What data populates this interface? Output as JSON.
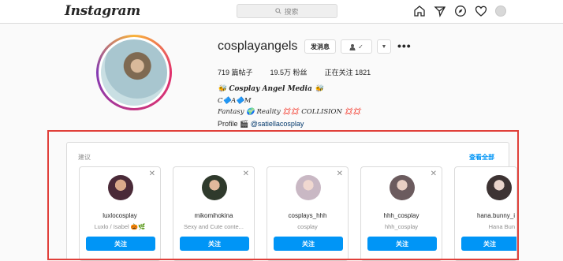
{
  "app": {
    "logo_text": "Instagram"
  },
  "search": {
    "placeholder": "搜索",
    "icon": "search-icon"
  },
  "nav": {
    "icons": [
      "home-icon",
      "direct-message-icon",
      "explore-compass-icon",
      "activity-heart-icon",
      "profile-avatar-icon"
    ]
  },
  "profile": {
    "username": "cosplayangels",
    "message_button": "发消息",
    "follow_button_icon": "person-check-icon",
    "follow_button_check": "✓",
    "dropdown_icon": "chevron-down-icon",
    "more_icon": "more-options-icon",
    "stats": {
      "posts": "719 篇帖子",
      "followers": "19.5万 粉丝",
      "following": "正在关注 1821"
    },
    "bio": {
      "line1": "𝑪𝒐𝒔𝒑𝒍𝒂𝒚 𝑨𝒏𝒈𝒆𝒍 𝑴𝒆𝒅𝒊𝒂",
      "line2": "C🔷A🔷M",
      "line3": "Fantasy 🌍 Reality 💢💢 COLLISION 💢💢",
      "line4_prefix": "Profile 🎬",
      "line4_link": "@satiellacosplay"
    }
  },
  "suggestions": {
    "title": "建议",
    "see_all": "查看全部",
    "close_glyph": "✕",
    "cards": [
      {
        "username": "luxlocosplay",
        "subtitle": "Luxlo / Isabel 🎃🌿",
        "button": "关注",
        "avatar_color": "#4a2a38"
      },
      {
        "username": "mikomihokina",
        "subtitle": "Sexy and Cute conte...",
        "button": "关注",
        "avatar_color": "#2f3a2c"
      },
      {
        "username": "cosplays_hhh",
        "subtitle": "cosplay",
        "button": "关注",
        "avatar_color": "#c9b8c4"
      },
      {
        "username": "hhh_cosplay",
        "subtitle": "hhh_cosplay",
        "button": "关注",
        "avatar_color": "#6b5b5e"
      },
      {
        "username": "hana.bunny_i",
        "subtitle": "Hana Bun",
        "button": "关注",
        "avatar_color": "#3d3333"
      }
    ]
  },
  "colors": {
    "accent_blue": "#0095f6",
    "highlight_red": "#e0403a",
    "link_blue": "#00376b"
  }
}
